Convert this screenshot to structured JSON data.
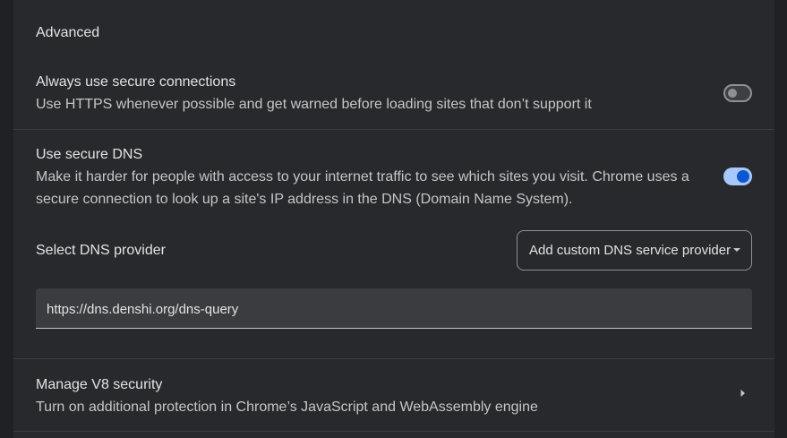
{
  "section": {
    "title": "Advanced"
  },
  "https_first": {
    "label": "Always use secure connections",
    "description": "Use HTTPS whenever possible and get warned before loading sites that don’t support it",
    "enabled": false
  },
  "secure_dns": {
    "label": "Use secure DNS",
    "description": "Make it harder for people with access to your internet traffic to see which sites you visit. Chrome uses a secure connection to look up a site's IP address in the DNS (Domain Name System).",
    "enabled": true,
    "provider_label": "Select DNS provider",
    "provider_selected": "Add custom DNS service provider",
    "custom_url": "https://dns.denshi.org/dns-query"
  },
  "v8": {
    "label": "Manage V8 security",
    "description": "Turn on additional protection in Chrome’s JavaScript and WebAssembly engine"
  },
  "colors": {
    "background": "#202124",
    "card": "#28292c",
    "toggle_on_track": "#a8c7fa",
    "toggle_on_knob": "#0b57d0",
    "text_primary": "#e3e3e3",
    "text_secondary": "#c4c7c5"
  },
  "icons": {
    "dropdown": "caret-down-icon",
    "v8_row": "chevron-right-icon"
  }
}
